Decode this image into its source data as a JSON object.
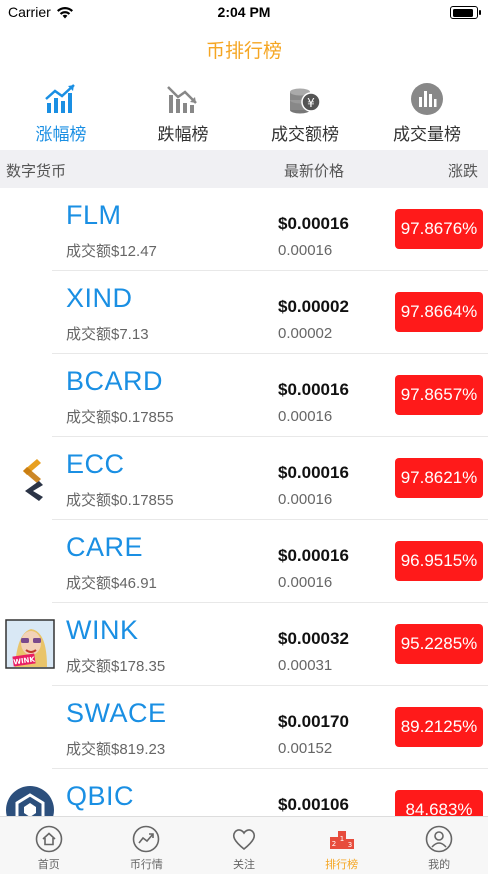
{
  "status_bar": {
    "carrier": "Carrier",
    "time": "2:04 PM",
    "battery_level": 0.9
  },
  "nav": {
    "title": "币排行榜"
  },
  "tabs": [
    {
      "label": "涨幅榜",
      "icon": "chart-up-icon",
      "active": true
    },
    {
      "label": "跌幅榜",
      "icon": "chart-down-icon",
      "active": false
    },
    {
      "label": "成交额榜",
      "icon": "coins-yen-icon",
      "active": false
    },
    {
      "label": "成交量榜",
      "icon": "volume-bars-icon",
      "active": false
    }
  ],
  "table_header": {
    "coin": "数字货币",
    "price": "最新价格",
    "change": "涨跌"
  },
  "rows": [
    {
      "symbol": "FLM",
      "volume": "成交额$12.47",
      "price_usd": "$0.00016",
      "price_raw": "0.00016",
      "change": "97.8676%",
      "logo": "none"
    },
    {
      "symbol": "XIND",
      "volume": "成交额$7.13",
      "price_usd": "$0.00002",
      "price_raw": "0.00002",
      "change": "97.8664%",
      "logo": "none"
    },
    {
      "symbol": "BCARD",
      "volume": "成交额$0.17855",
      "price_usd": "$0.00016",
      "price_raw": "0.00016",
      "change": "97.8657%",
      "logo": "none"
    },
    {
      "symbol": "ECC",
      "volume": "成交额$0.17855",
      "price_usd": "$0.00016",
      "price_raw": "0.00016",
      "change": "97.8621%",
      "logo": "ecc-logo-icon"
    },
    {
      "symbol": "CARE",
      "volume": "成交额$46.91",
      "price_usd": "$0.00016",
      "price_raw": "0.00016",
      "change": "96.9515%",
      "logo": "none"
    },
    {
      "symbol": "WINK",
      "volume": "成交额$178.35",
      "price_usd": "$0.00032",
      "price_raw": "0.00031",
      "change": "95.2285%",
      "logo": "wink-logo-icon"
    },
    {
      "symbol": "SWACE",
      "volume": "成交额$819.23",
      "price_usd": "$0.00170",
      "price_raw": "0.00152",
      "change": "89.2125%",
      "logo": "none"
    },
    {
      "symbol": "QBIC",
      "volume": "",
      "price_usd": "$0.00106",
      "price_raw": "",
      "change": "84.683%",
      "logo": "qbic-logo-icon"
    }
  ],
  "bottom_bar": [
    {
      "label": "首页",
      "icon": "home-icon",
      "active": false
    },
    {
      "label": "币行情",
      "icon": "market-chart-icon",
      "active": false
    },
    {
      "label": "关注",
      "icon": "heart-icon",
      "active": false
    },
    {
      "label": "排行榜",
      "icon": "podium-icon",
      "active": true
    },
    {
      "label": "我的",
      "icon": "user-icon",
      "active": false
    }
  ],
  "colors": {
    "accent_orange": "#f5a623",
    "accent_blue": "#1a8fe3",
    "badge_red": "#ff1a1a"
  }
}
